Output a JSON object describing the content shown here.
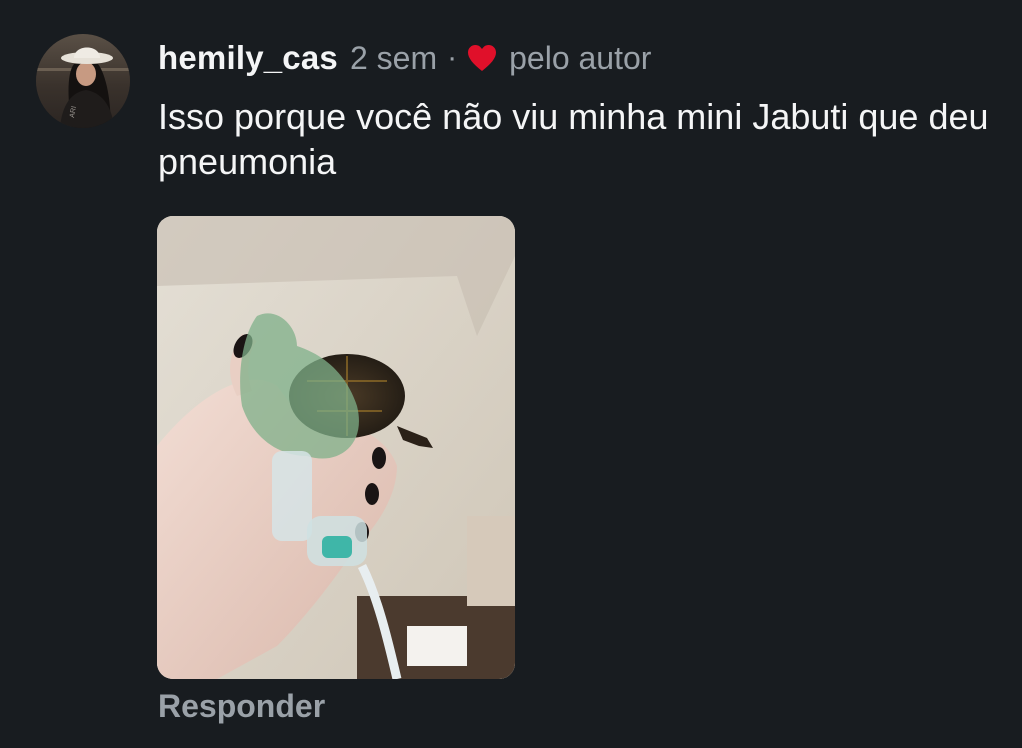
{
  "comment": {
    "username": "hemily_cas",
    "time_ago": "2 sem",
    "separator": "·",
    "liked_by_author": "pelo autor",
    "text": "Isso porque você não viu minha mini Jabuti que deu pneumonia",
    "reply_label": "Responder",
    "photo_icon": "photo-turtle-nebulizer",
    "heart_color": "#e0102a"
  },
  "colors": {
    "background": "#181c20",
    "primary_text": "#f4f5f6",
    "secondary_text": "#9aa1a8"
  }
}
